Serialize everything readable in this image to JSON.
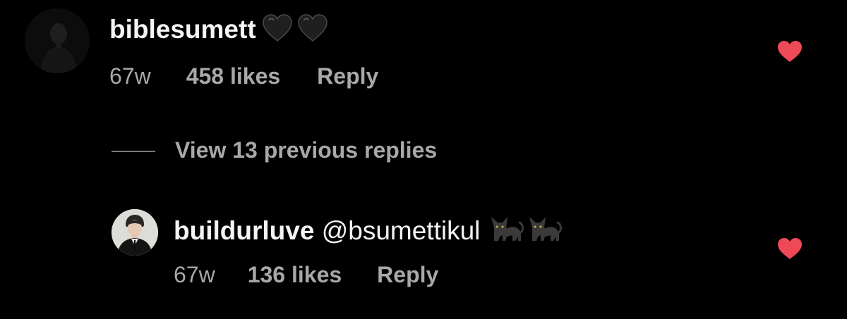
{
  "comments": [
    {
      "username": "biblesumett",
      "text": "",
      "emoji": [
        "black-heart",
        "black-heart"
      ],
      "time": "67w",
      "likes": "458 likes",
      "reply": "Reply",
      "liked": true
    }
  ],
  "view_replies": {
    "label": "View 13 previous replies"
  },
  "replies": [
    {
      "username": "buildurluve",
      "text": "@bsumettikul",
      "emoji": [
        "black-cat",
        "black-cat"
      ],
      "time": "67w",
      "likes": "136 likes",
      "reply": "Reply",
      "liked": true
    }
  ],
  "colors": {
    "background": "#000000",
    "primary_text": "#f5f5f5",
    "secondary_text": "#a8a8a8",
    "like_heart": "#ed4956"
  }
}
